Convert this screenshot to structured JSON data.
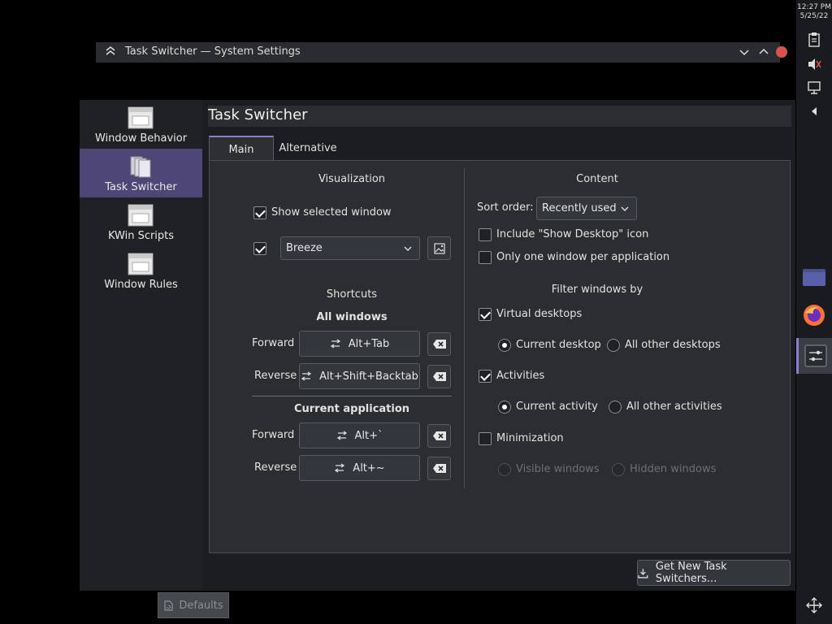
{
  "window": {
    "title": "Task Switcher — System Settings"
  },
  "sidebar": {
    "items": [
      {
        "label": "Window Behavior",
        "icon": "window-behavior-icon"
      },
      {
        "label": "Task Switcher",
        "icon": "task-switcher-icon",
        "active": true
      },
      {
        "label": "KWin Scripts",
        "icon": "kwin-scripts-icon"
      },
      {
        "label": "Window Rules",
        "icon": "window-rules-icon"
      }
    ]
  },
  "page": {
    "title": "Task Switcher",
    "tabs": [
      {
        "label": "Main",
        "active": true
      },
      {
        "label": "Alternative",
        "active": false
      }
    ]
  },
  "visualization": {
    "heading": "Visualization",
    "show_selected_window": {
      "label": "Show selected window",
      "checked": true
    },
    "theme": {
      "value": "Breeze",
      "checked": true
    }
  },
  "shortcuts": {
    "heading": "Shortcuts",
    "all_windows": {
      "heading": "All windows",
      "forward": {
        "label": "Forward",
        "key": "Alt+Tab"
      },
      "reverse": {
        "label": "Reverse",
        "key": "Alt+Shift+Backtab"
      }
    },
    "current_application": {
      "heading": "Current application",
      "forward": {
        "label": "Forward",
        "key": "Alt+`"
      },
      "reverse": {
        "label": "Reverse",
        "key": "Alt+~"
      }
    }
  },
  "content": {
    "heading": "Content",
    "sort_order": {
      "label": "Sort order:",
      "value": "Recently used"
    },
    "include_show_desktop": {
      "label": "Include \"Show Desktop\" icon",
      "checked": false
    },
    "one_window_per_app": {
      "label": "Only one window per application",
      "checked": false
    }
  },
  "filter": {
    "heading": "Filter windows by",
    "virtual_desktops": {
      "label": "Virtual desktops",
      "checked": true
    },
    "current_desktop": {
      "label": "Current desktop",
      "selected": true
    },
    "all_other_desktops": {
      "label": "All other desktops",
      "selected": false
    },
    "activities": {
      "label": "Activities",
      "checked": true
    },
    "current_activity": {
      "label": "Current activity",
      "selected": true
    },
    "all_other_activities": {
      "label": "All other activities",
      "selected": false
    },
    "minimization": {
      "label": "Minimization",
      "checked": false
    },
    "visible_windows": {
      "label": "Visible windows",
      "disabled": true
    },
    "hidden_windows": {
      "label": "Hidden windows",
      "disabled": true
    }
  },
  "buttons": {
    "get_new": "Get New Task Switchers...",
    "defaults": "Defaults"
  },
  "panel": {
    "time": "12:27 PM",
    "date": "5/25/22"
  },
  "colors": {
    "accent": "#4e4674",
    "background": "#2b2d31"
  }
}
